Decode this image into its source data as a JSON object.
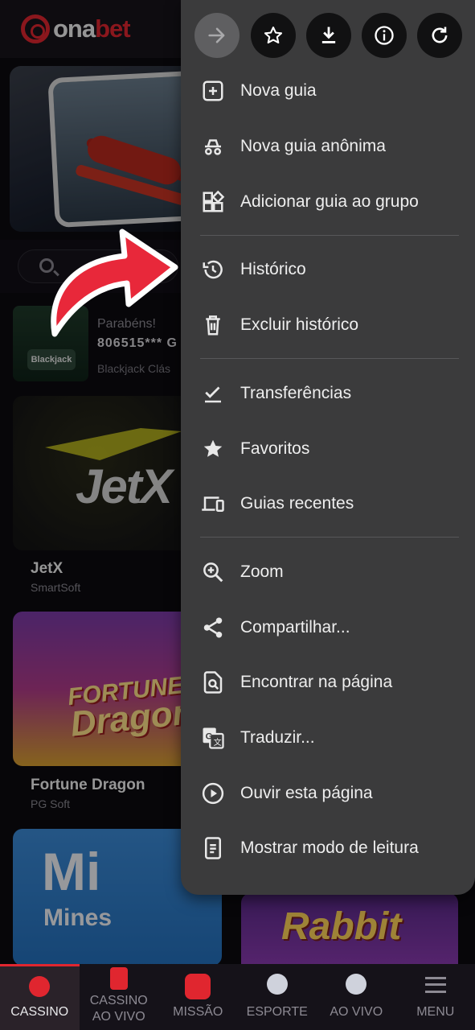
{
  "app": {
    "logo_text_white": "ona",
    "logo_text_red": "bet"
  },
  "ticker": {
    "line1": "Parabéns!",
    "line2": "806515*** G",
    "line3": "Blackjack Clás",
    "thumb_label": "Blackjack"
  },
  "games": [
    {
      "title": "JetX",
      "provider": "SmartSoft",
      "art_text": "JetX"
    },
    {
      "title": "Fortune Dragon",
      "provider": "PG Soft",
      "art_line1": "FORTUNE",
      "art_line2": "Dragon"
    },
    {
      "art_line1": "Mi",
      "art_line2": "Mines"
    },
    {
      "art_text": "Rabbit"
    }
  ],
  "bottom_nav": [
    {
      "label": "CASSINO",
      "active": true
    },
    {
      "label": "CASSINO AO VIVO"
    },
    {
      "label": "MISSÃO"
    },
    {
      "label": "ESPORTE"
    },
    {
      "label": "AO VIVO"
    },
    {
      "label": "MENU"
    }
  ],
  "browser_menu": {
    "toolbar": [
      "forward-icon",
      "star-icon",
      "download-icon",
      "info-icon",
      "refresh-icon"
    ],
    "items": [
      {
        "label": "Nova guia",
        "icon": "new-tab-icon"
      },
      {
        "label": "Nova guia anônima",
        "icon": "incognito-icon"
      },
      {
        "label": "Adicionar guia ao grupo",
        "icon": "tab-group-icon"
      },
      {
        "label": "Histórico",
        "icon": "history-icon"
      },
      {
        "label": "Excluir histórico",
        "icon": "trash-icon"
      },
      {
        "label": "Transferências",
        "icon": "downloads-check-icon"
      },
      {
        "label": "Favoritos",
        "icon": "bookmark-star-icon"
      },
      {
        "label": "Guias recentes",
        "icon": "devices-icon"
      },
      {
        "label": "Zoom",
        "icon": "zoom-icon"
      },
      {
        "label": "Compartilhar...",
        "icon": "share-icon"
      },
      {
        "label": "Encontrar na página",
        "icon": "find-in-page-icon"
      },
      {
        "label": "Traduzir...",
        "icon": "translate-icon"
      },
      {
        "label": "Ouvir esta página",
        "icon": "play-icon"
      },
      {
        "label": "Mostrar modo de leitura",
        "icon": "reader-mode-icon"
      }
    ]
  },
  "colors": {
    "brand_red": "#e0262f",
    "menu_bg": "#3b3b3c",
    "annotation_arrow": "#e8283a"
  }
}
